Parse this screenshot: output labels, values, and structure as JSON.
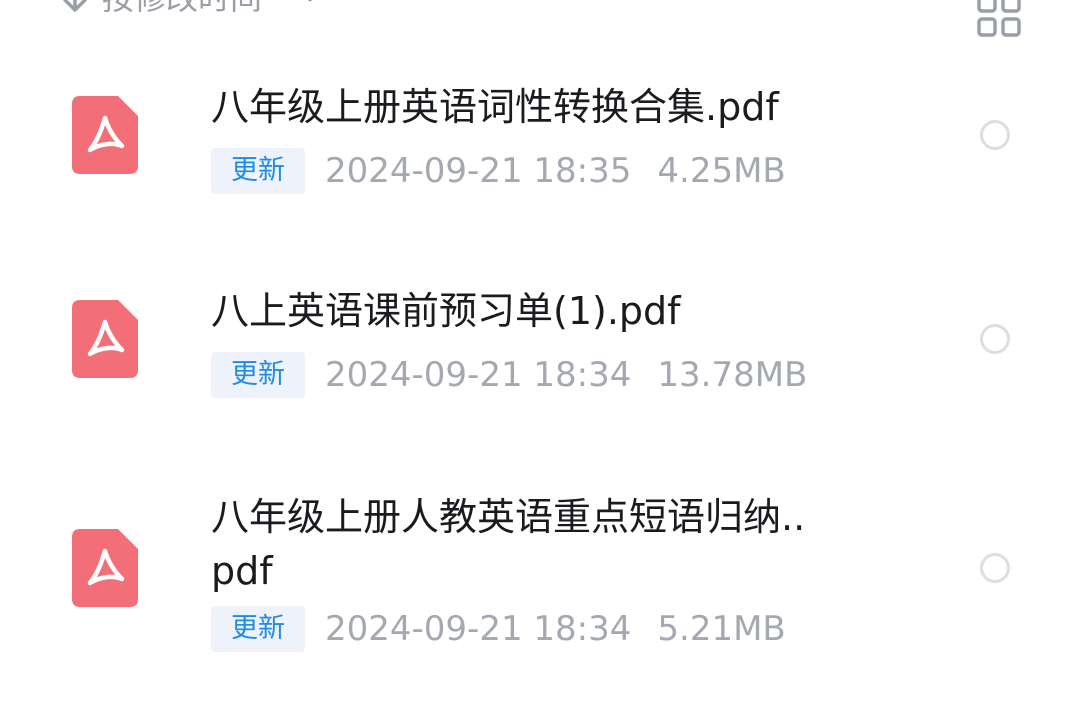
{
  "sort": {
    "label": "按修改时间"
  },
  "icons": {
    "sort_arrow": "arrow-down-icon",
    "sort_chevron": "chevron-down-icon",
    "grid_toggle": "grid-view-icon",
    "file": "pdf-file-icon",
    "select": "select-circle-icon"
  },
  "colors": {
    "pdf_icon": "#f36f77",
    "tag_bg": "#eef3fb",
    "tag_text": "#1e8be6",
    "meta_text": "#a4a8b0",
    "title_text": "#1b1b1f"
  },
  "files": [
    {
      "name": "八年级上册英语词性转换合集.pdf",
      "tag": "更新",
      "date": "2024-09-21  18:35",
      "size": "4.25MB"
    },
    {
      "name": "八上英语课前预习单(1).pdf",
      "tag": "更新",
      "date": "2024-09-21  18:34",
      "size": "13.78MB"
    },
    {
      "name": "八年级上册人教英语重点短语归纳..pdf",
      "tag": "更新",
      "date": "2024-09-21  18:34",
      "size": "5.21MB"
    }
  ]
}
